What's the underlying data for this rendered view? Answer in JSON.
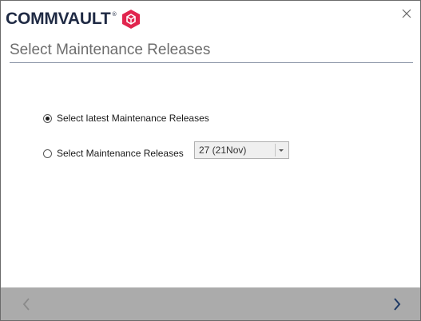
{
  "header": {
    "logo_text": "COMMVAULT",
    "logo_trademark": "®",
    "brand_color": "#e1254e",
    "text_color": "#1f2a44",
    "close_icon": "close-icon"
  },
  "page": {
    "title": "Select Maintenance Releases"
  },
  "options": {
    "latest_label": "Select latest Maintenance Releases",
    "latest_selected": true,
    "specific_label": "Select Maintenance Releases",
    "specific_selected": false,
    "release_select_value": "27 (21Nov)"
  },
  "footer": {
    "background": "#ababab",
    "back_icon": "chevron-left-icon",
    "next_icon": "chevron-right-icon"
  }
}
